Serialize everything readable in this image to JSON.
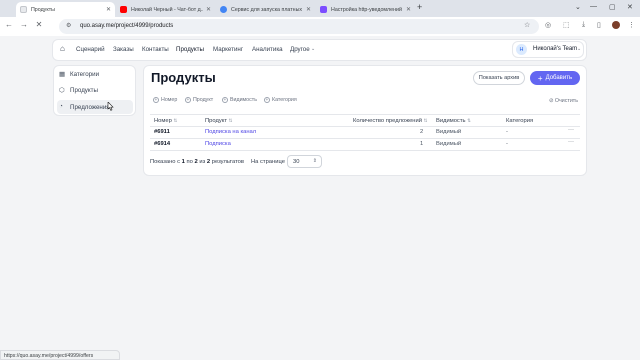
{
  "browser": {
    "tabs": [
      {
        "title": "Продукты",
        "color": "#ffffff",
        "active": true
      },
      {
        "title": "Николай Черный - Чат-бот д...",
        "color": "#ff0000",
        "active": false
      },
      {
        "title": "Сервис для запуска платных с...",
        "color": "#4285f4",
        "active": false
      },
      {
        "title": "Настройка http-уведомлений ...",
        "color": "#7c4dff",
        "active": false
      }
    ],
    "new_tab": "+",
    "url": "quo.asay.me/project/4999/products",
    "status_url": "https://quo.asay.me/project/4999/offers"
  },
  "nav": {
    "items": [
      "Сценарий",
      "Заказы",
      "Контакты",
      "Продукты",
      "Маркетинг",
      "Аналитика",
      "Другое"
    ],
    "team": "Николай's Team",
    "team_initial": "Н"
  },
  "sidebar": {
    "items": [
      {
        "label": "Категории",
        "icon": "grid-icon"
      },
      {
        "label": "Продукты",
        "icon": "box-icon"
      },
      {
        "label": "Предложения",
        "icon": "tag-icon"
      }
    ]
  },
  "page": {
    "title": "Продукты",
    "archive_label": "Показать архив",
    "add_label": "Добавить",
    "filters": [
      "Номер",
      "Продукт",
      "Видимость",
      "Категория"
    ],
    "clear_label": "Очистить"
  },
  "table": {
    "headers": [
      "Номер",
      "Продукт",
      "Количество предложений",
      "Видимость",
      "Категория"
    ],
    "rows": [
      {
        "id": "#6911",
        "product": "Подписка на канал",
        "offers": "2",
        "visibility": "Видимый",
        "category": "-"
      },
      {
        "id": "#6914",
        "product": "Подписка",
        "offers": "1",
        "visibility": "Видимый",
        "category": "-"
      }
    ]
  },
  "pagination": {
    "prefix": "Показано с",
    "from": "1",
    "to_word": "по",
    "to": "2",
    "of_word": "из",
    "total": "2",
    "suffix": "результатов",
    "per_page_label": "На странице",
    "per_page": "30"
  },
  "colors": {
    "accent": "#6366f1",
    "link": "#4f46e5"
  }
}
